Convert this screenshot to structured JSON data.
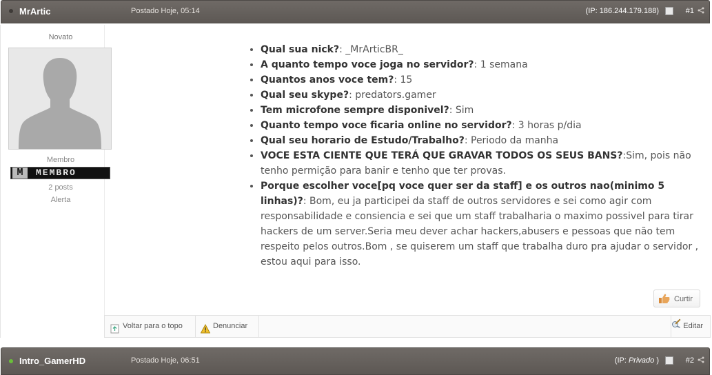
{
  "posts": [
    {
      "author": "MrArtic",
      "posted": "Postado Hoje, 05:14",
      "ip_prefix": "(IP: ",
      "ip_value": "186.244.179.188",
      "ip_suffix": ")",
      "number": "#1"
    },
    {
      "author": "Intro_GamerHD",
      "posted": "Postado Hoje, 06:51",
      "ip_prefix": "(IP: ",
      "ip_value": "Privado",
      "ip_suffix": " )",
      "number": "#2"
    }
  ],
  "profile": {
    "rank": "Novato",
    "group": "Membro",
    "badge_letter": "M",
    "badge_text": "MEMBRO",
    "posts": "2 posts",
    "warn": "Alerta"
  },
  "answers": [
    {
      "q": "Qual sua nick?",
      "a": ": _MrArticBR_"
    },
    {
      "q": "A quanto tempo voce joga no servidor?",
      "a": ": 1 semana"
    },
    {
      "q": "Quantos anos voce tem?",
      "a": ": 15"
    },
    {
      "q": "Qual seu skype?",
      "a": ": predators.gamer"
    },
    {
      "q": "Tem microfone sempre disponivel?",
      "a": ": Sim"
    },
    {
      "q": "Quanto tempo voce ficaria online no servidor?",
      "a": ": 3 horas p/dia"
    },
    {
      "q": "Qual seu horario de Estudo/Trabalho?",
      "a": ": Periodo da manha"
    },
    {
      "q": "VOCE ESTA CIENTE QUE TERÁ QUE GRAVAR TODOS OS SEUS BANS?",
      "a": ":Sim, pois não tenho permição para banir e tenho que ter provas."
    },
    {
      "q": "Porque escolher voce[pq voce quer ser da staff] e os outros nao(minimo 5 linhas)?",
      "a": ": Bom, eu ja participei da staff de outros servidores e sei como agir com responsabilidade e consiencia e sei que um staff trabalharia o maximo possivel para tirar hackers de um server.Seria meu dever achar hackers,abusers e pessoas que não tem respeito pelos outros.Bom , se quiserem um staff que trabalha duro pra ajudar o servidor , estou aqui para isso."
    }
  ],
  "actions": {
    "like": "Curtir",
    "back_to_top": "Voltar para o topo",
    "report": "Denunciar",
    "edit": "Editar"
  },
  "colors": {
    "header_bg": "#66615d",
    "online": "#6abf3a",
    "offline": "#3e3a37"
  }
}
